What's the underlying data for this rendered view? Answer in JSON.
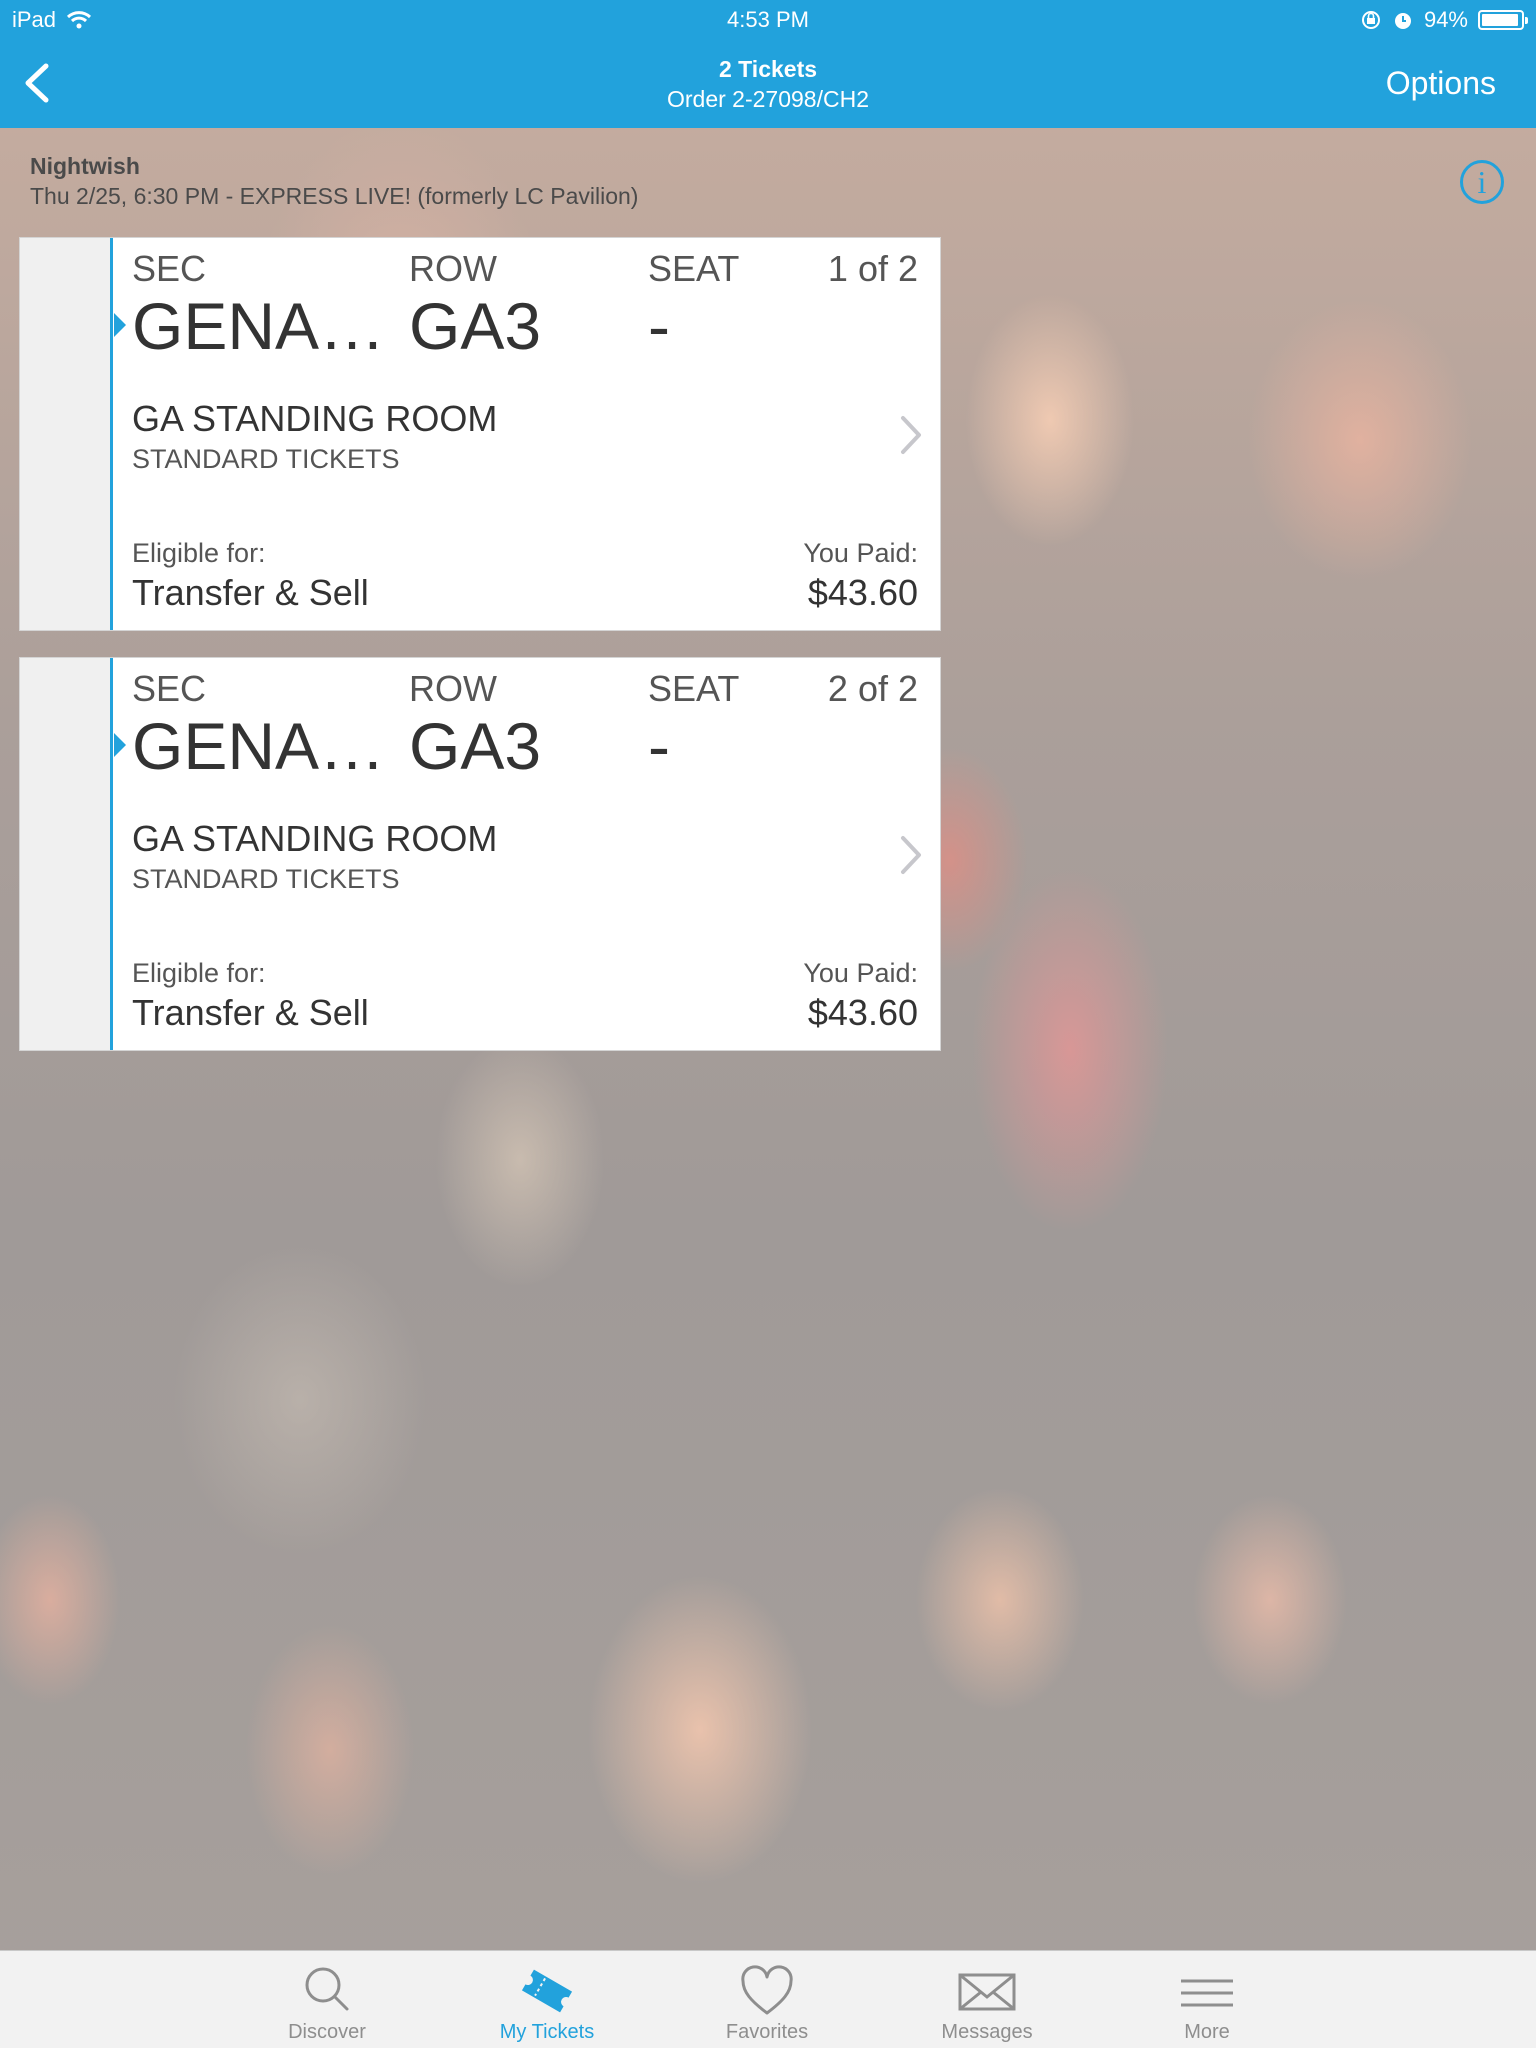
{
  "status_bar": {
    "device": "iPad",
    "time": "4:53 PM",
    "battery_percent": "94%",
    "battery_level": 0.94,
    "icons": [
      "wifi-icon",
      "orientation-lock-icon",
      "alarm-icon",
      "battery-icon"
    ]
  },
  "nav": {
    "title": "2 Tickets",
    "subtitle": "Order 2-27098/CH2",
    "options_label": "Options",
    "back_icon": "chevron-left-icon"
  },
  "event": {
    "name": "Nightwish",
    "detail": "Thu 2/25, 6:30 PM - EXPRESS LIVE! (formerly LC Pavilion)",
    "info_icon": "info-icon",
    "info_glyph": "i"
  },
  "tickets": [
    {
      "sec_label": "SEC",
      "sec_value": "GENA…",
      "row_label": "ROW",
      "row_value": "GA3",
      "seat_label": "SEAT",
      "seat_value": "-",
      "count": "1 of 2",
      "area": "GA STANDING ROOM",
      "type": "STANDARD TICKETS",
      "eligible_label": "Eligible for:",
      "eligible_value": "Transfer & Sell",
      "paid_label": "You Paid:",
      "paid_value": "$43.60"
    },
    {
      "sec_label": "SEC",
      "sec_value": "GENA…",
      "row_label": "ROW",
      "row_value": "GA3",
      "seat_label": "SEAT",
      "seat_value": "-",
      "count": "2 of 2",
      "area": "GA STANDING ROOM",
      "type": "STANDARD TICKETS",
      "eligible_label": "Eligible for:",
      "eligible_value": "Transfer & Sell",
      "paid_label": "You Paid:",
      "paid_value": "$43.60"
    }
  ],
  "tab_bar": {
    "active": "My Tickets",
    "items": [
      {
        "label": "Discover",
        "icon": "search-icon"
      },
      {
        "label": "My Tickets",
        "icon": "ticket-icon"
      },
      {
        "label": "Favorites",
        "icon": "heart-icon"
      },
      {
        "label": "Messages",
        "icon": "envelope-icon"
      },
      {
        "label": "More",
        "icon": "menu-icon"
      }
    ]
  },
  "colors": {
    "accent": "#22a2dc",
    "tab_inactive": "#8e8e8e",
    "text_dark": "#333333"
  }
}
